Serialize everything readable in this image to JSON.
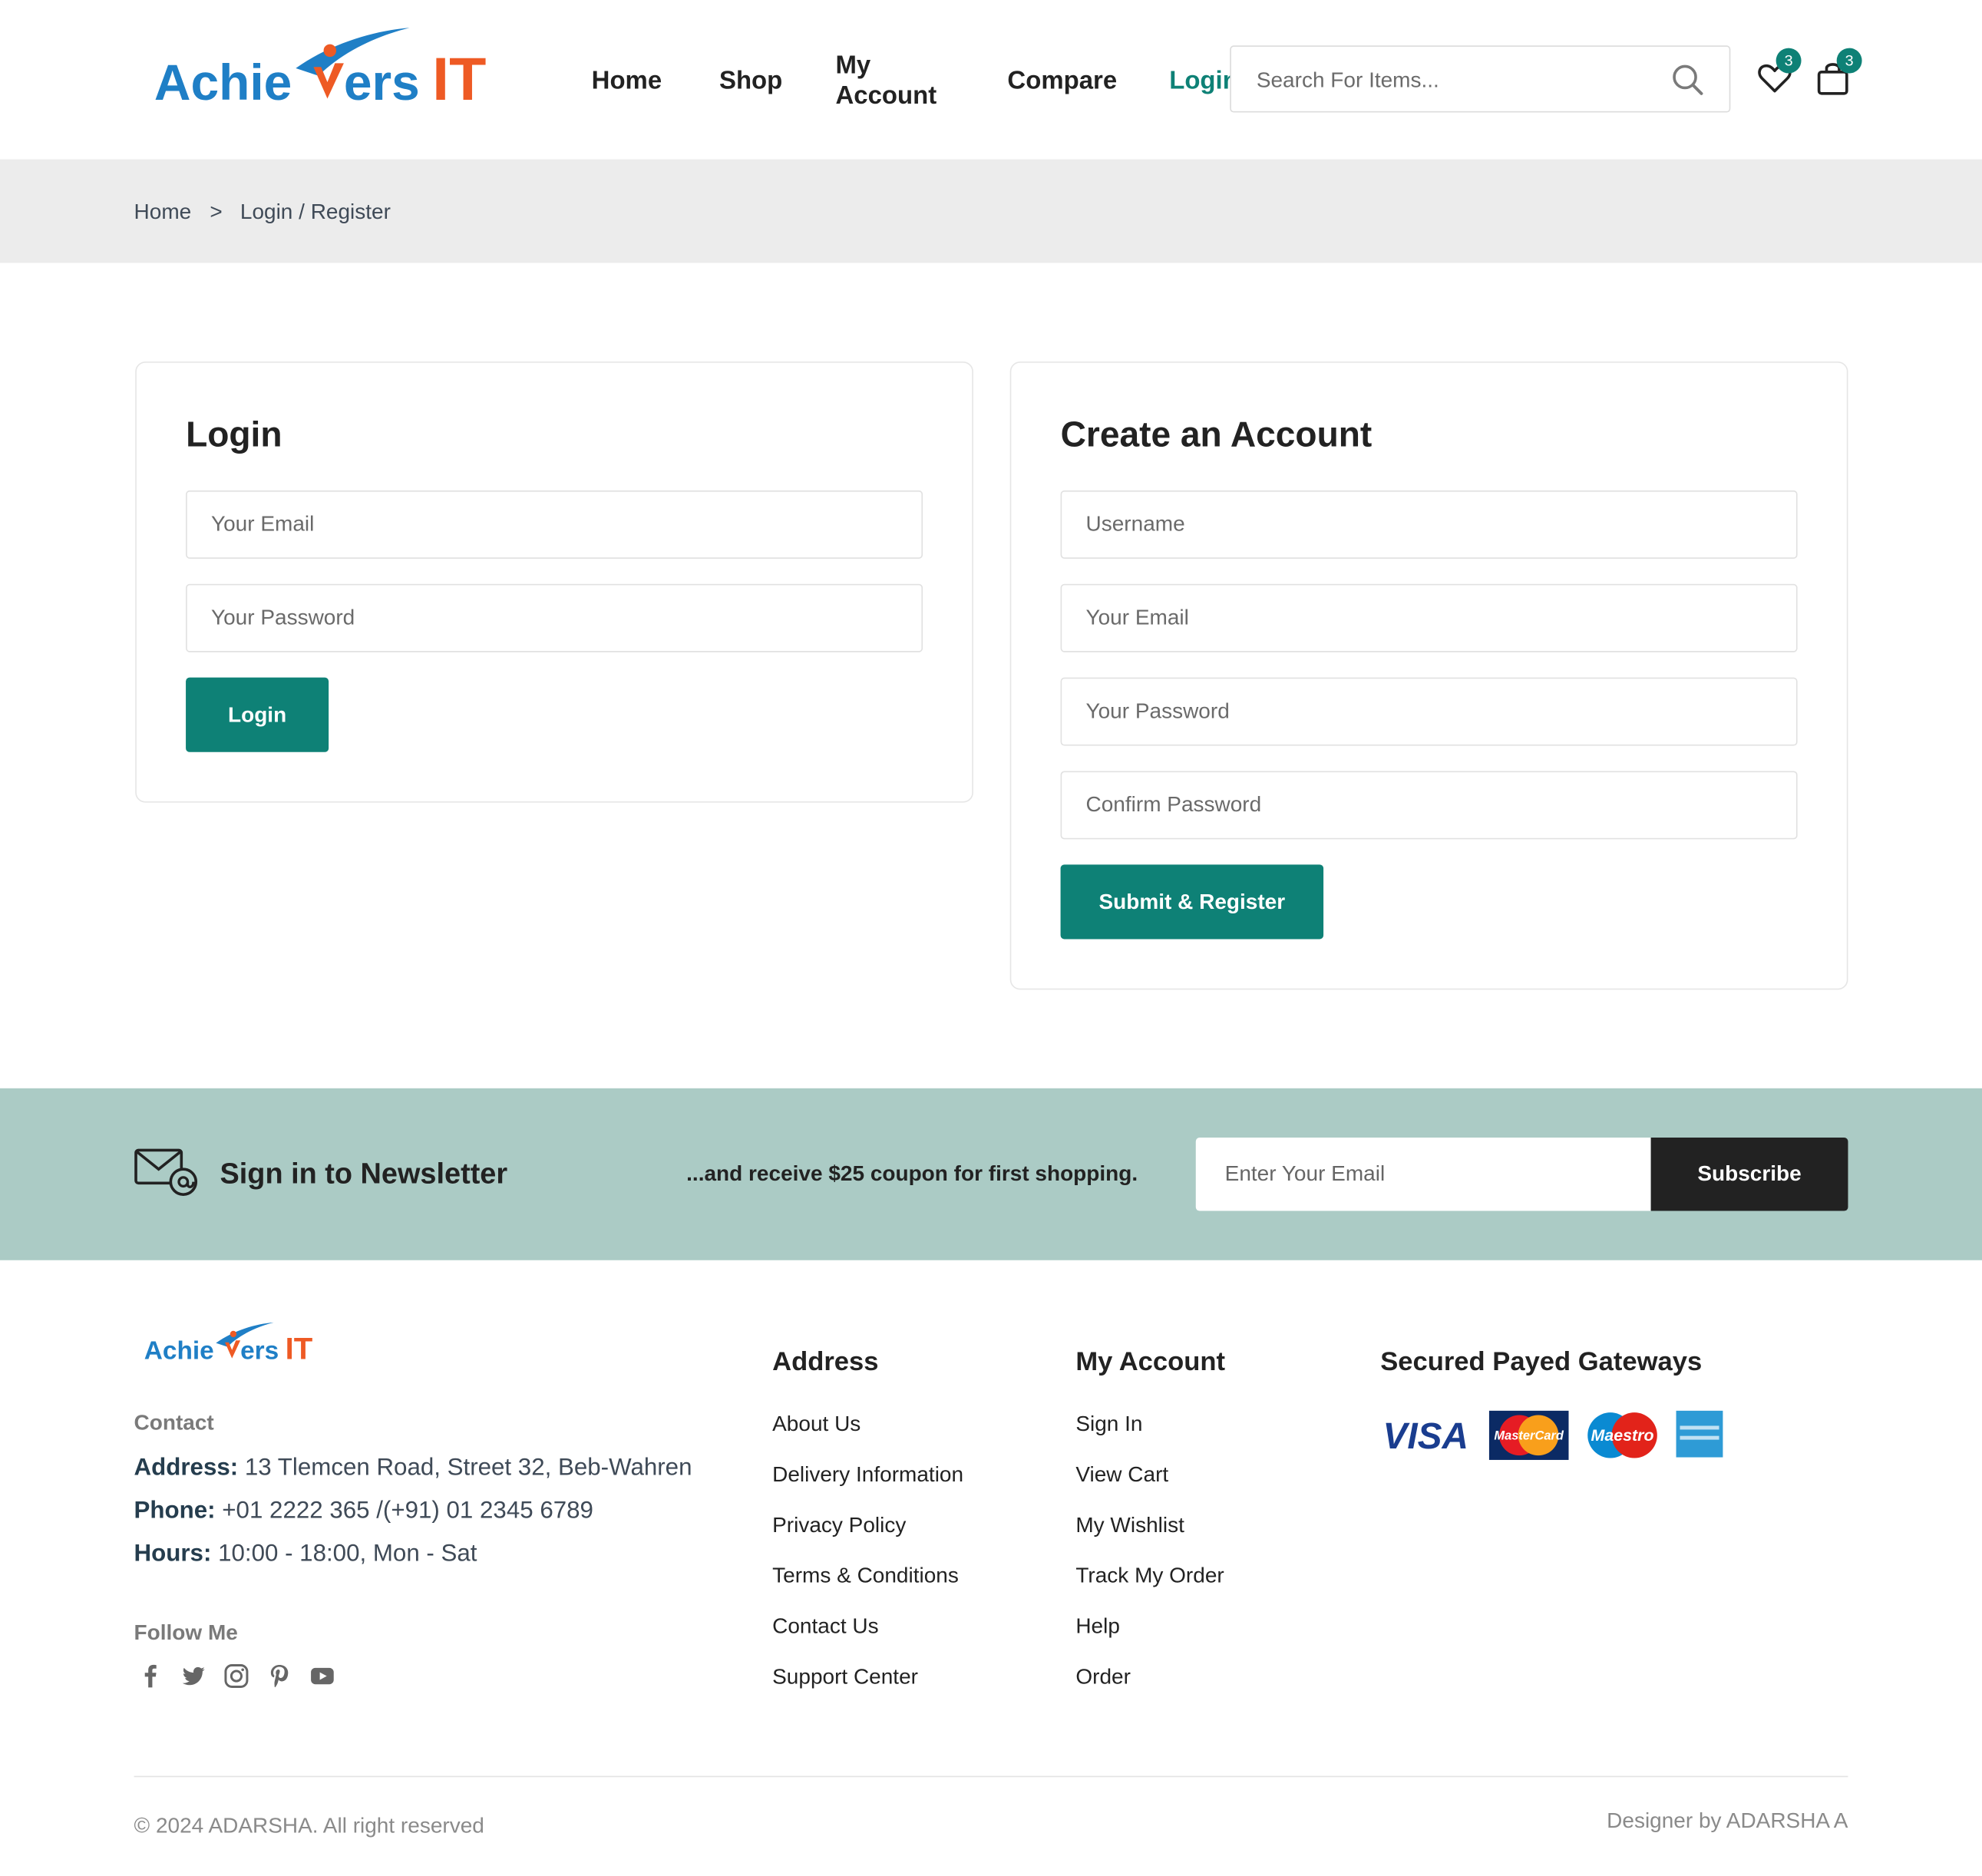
{
  "header": {
    "logo_text_a": "Achie",
    "logo_text_b": "ers",
    "logo_text_c": "IT",
    "nav": {
      "home": "Home",
      "shop": "Shop",
      "my_account_1": "My",
      "my_account_2": "Account",
      "compare": "Compare",
      "login": "Login"
    },
    "search_placeholder": "Search For Items...",
    "wishlist_count": "3",
    "cart_count": "3"
  },
  "breadcrumb": {
    "home": "Home",
    "separator": ">",
    "current": "Login / Register"
  },
  "login_form": {
    "title": "Login",
    "email_placeholder": "Your Email",
    "password_placeholder": "Your Password",
    "button": "Login"
  },
  "register_form": {
    "title": "Create an Account",
    "username_placeholder": "Username",
    "email_placeholder": "Your Email",
    "password_placeholder": "Your Password",
    "confirm_placeholder": "Confirm Password",
    "button": "Submit & Register"
  },
  "newsletter": {
    "title": "Sign in to Newsletter",
    "subtitle": "...and receive $25 coupon for first shopping.",
    "email_placeholder": "Enter Your Email",
    "button": "Subscribe"
  },
  "footer": {
    "contact_label": "Contact",
    "address_label": "Address:",
    "address_value": "13 Tlemcen Road, Street 32, Beb-Wahren",
    "phone_label": "Phone:",
    "phone_value": "+01 2222 365 /(+91) 01 2345 6789",
    "hours_label": "Hours:",
    "hours_value": "10:00 - 18:00, Mon - Sat",
    "follow_label": "Follow Me",
    "address_col": {
      "title": "Address",
      "links": [
        "About Us",
        "Delivery Information",
        "Privacy Policy",
        "Terms & Conditions",
        "Contact Us",
        "Support Center"
      ]
    },
    "account_col": {
      "title": "My Account",
      "links": [
        "Sign In",
        "View Cart",
        "My Wishlist",
        "Track My Order",
        "Help",
        "Order"
      ]
    },
    "gateways": {
      "title": "Secured Payed Gateways",
      "visa": "VISA",
      "mastercard": "MasterCard",
      "maestro": "Maestro"
    },
    "copyright": "© 2024 ADARSHA. All right reserved",
    "designer": "Designer by ADARSHA A"
  },
  "colors": {
    "accent": "#0e8176",
    "logo_blue": "#1f7fc6",
    "logo_orange": "#ee5a24",
    "newsletter_bg": "#abcbc5",
    "breadcrumb_bg": "#ececec"
  }
}
